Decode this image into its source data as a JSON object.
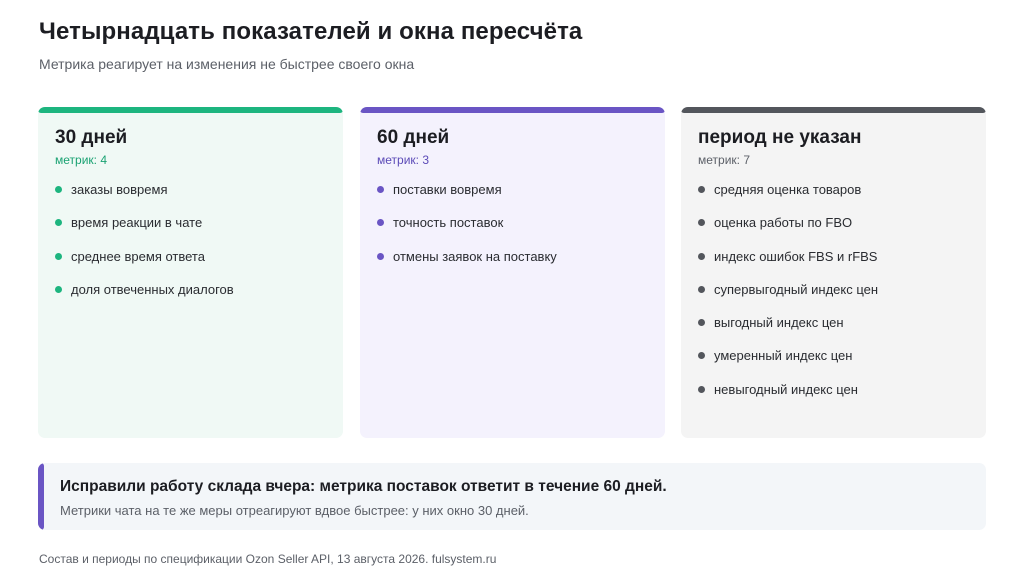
{
  "header": {
    "title": "Четырнадцать показателей и окна пересчёта",
    "subtitle": "Метрика реагирует на изменения не быстрее своего окна"
  },
  "cards": [
    {
      "title": "30 дней",
      "count_label": "метрик: 4",
      "accent_color": "#1db57f",
      "background_color": "#f0f9f5",
      "count_color": "#1aa272",
      "items": [
        "заказы вовремя",
        "время реакции в чате",
        "среднее время ответа",
        "доля отвеченных диалогов"
      ]
    },
    {
      "title": "60 дней",
      "count_label": "метрик: 3",
      "accent_color": "#6a55c4",
      "background_color": "#f4f2fd",
      "count_color": "#5b4ab7",
      "items": [
        "поставки вовремя",
        "точность поставок",
        "отмены заявок на поставку"
      ]
    },
    {
      "title": "период не указан",
      "count_label": "метрик: 7",
      "accent_color": "#53565c",
      "background_color": "#f4f4f4",
      "count_color": "#5c6068",
      "items": [
        "средняя оценка товаров",
        "оценка работы по FBO",
        "индекс ошибок FBS и rFBS",
        "супервыгодный индекс цен",
        "выгодный индекс цен",
        "умеренный индекс цен",
        "невыгодный индекс цен"
      ]
    }
  ],
  "callout": {
    "title": "Исправили работу склада вчера: метрика поставок ответит в течение 60 дней.",
    "text": "Метрики чата на те же меры отреагируют вдвое быстрее: у них окно 30 дней.",
    "accent_color": "#6a55c4"
  },
  "footer": {
    "text": "Состав и периоды по спецификации Ozon Seller API, 13 августа 2026. fulsystem.ru"
  }
}
